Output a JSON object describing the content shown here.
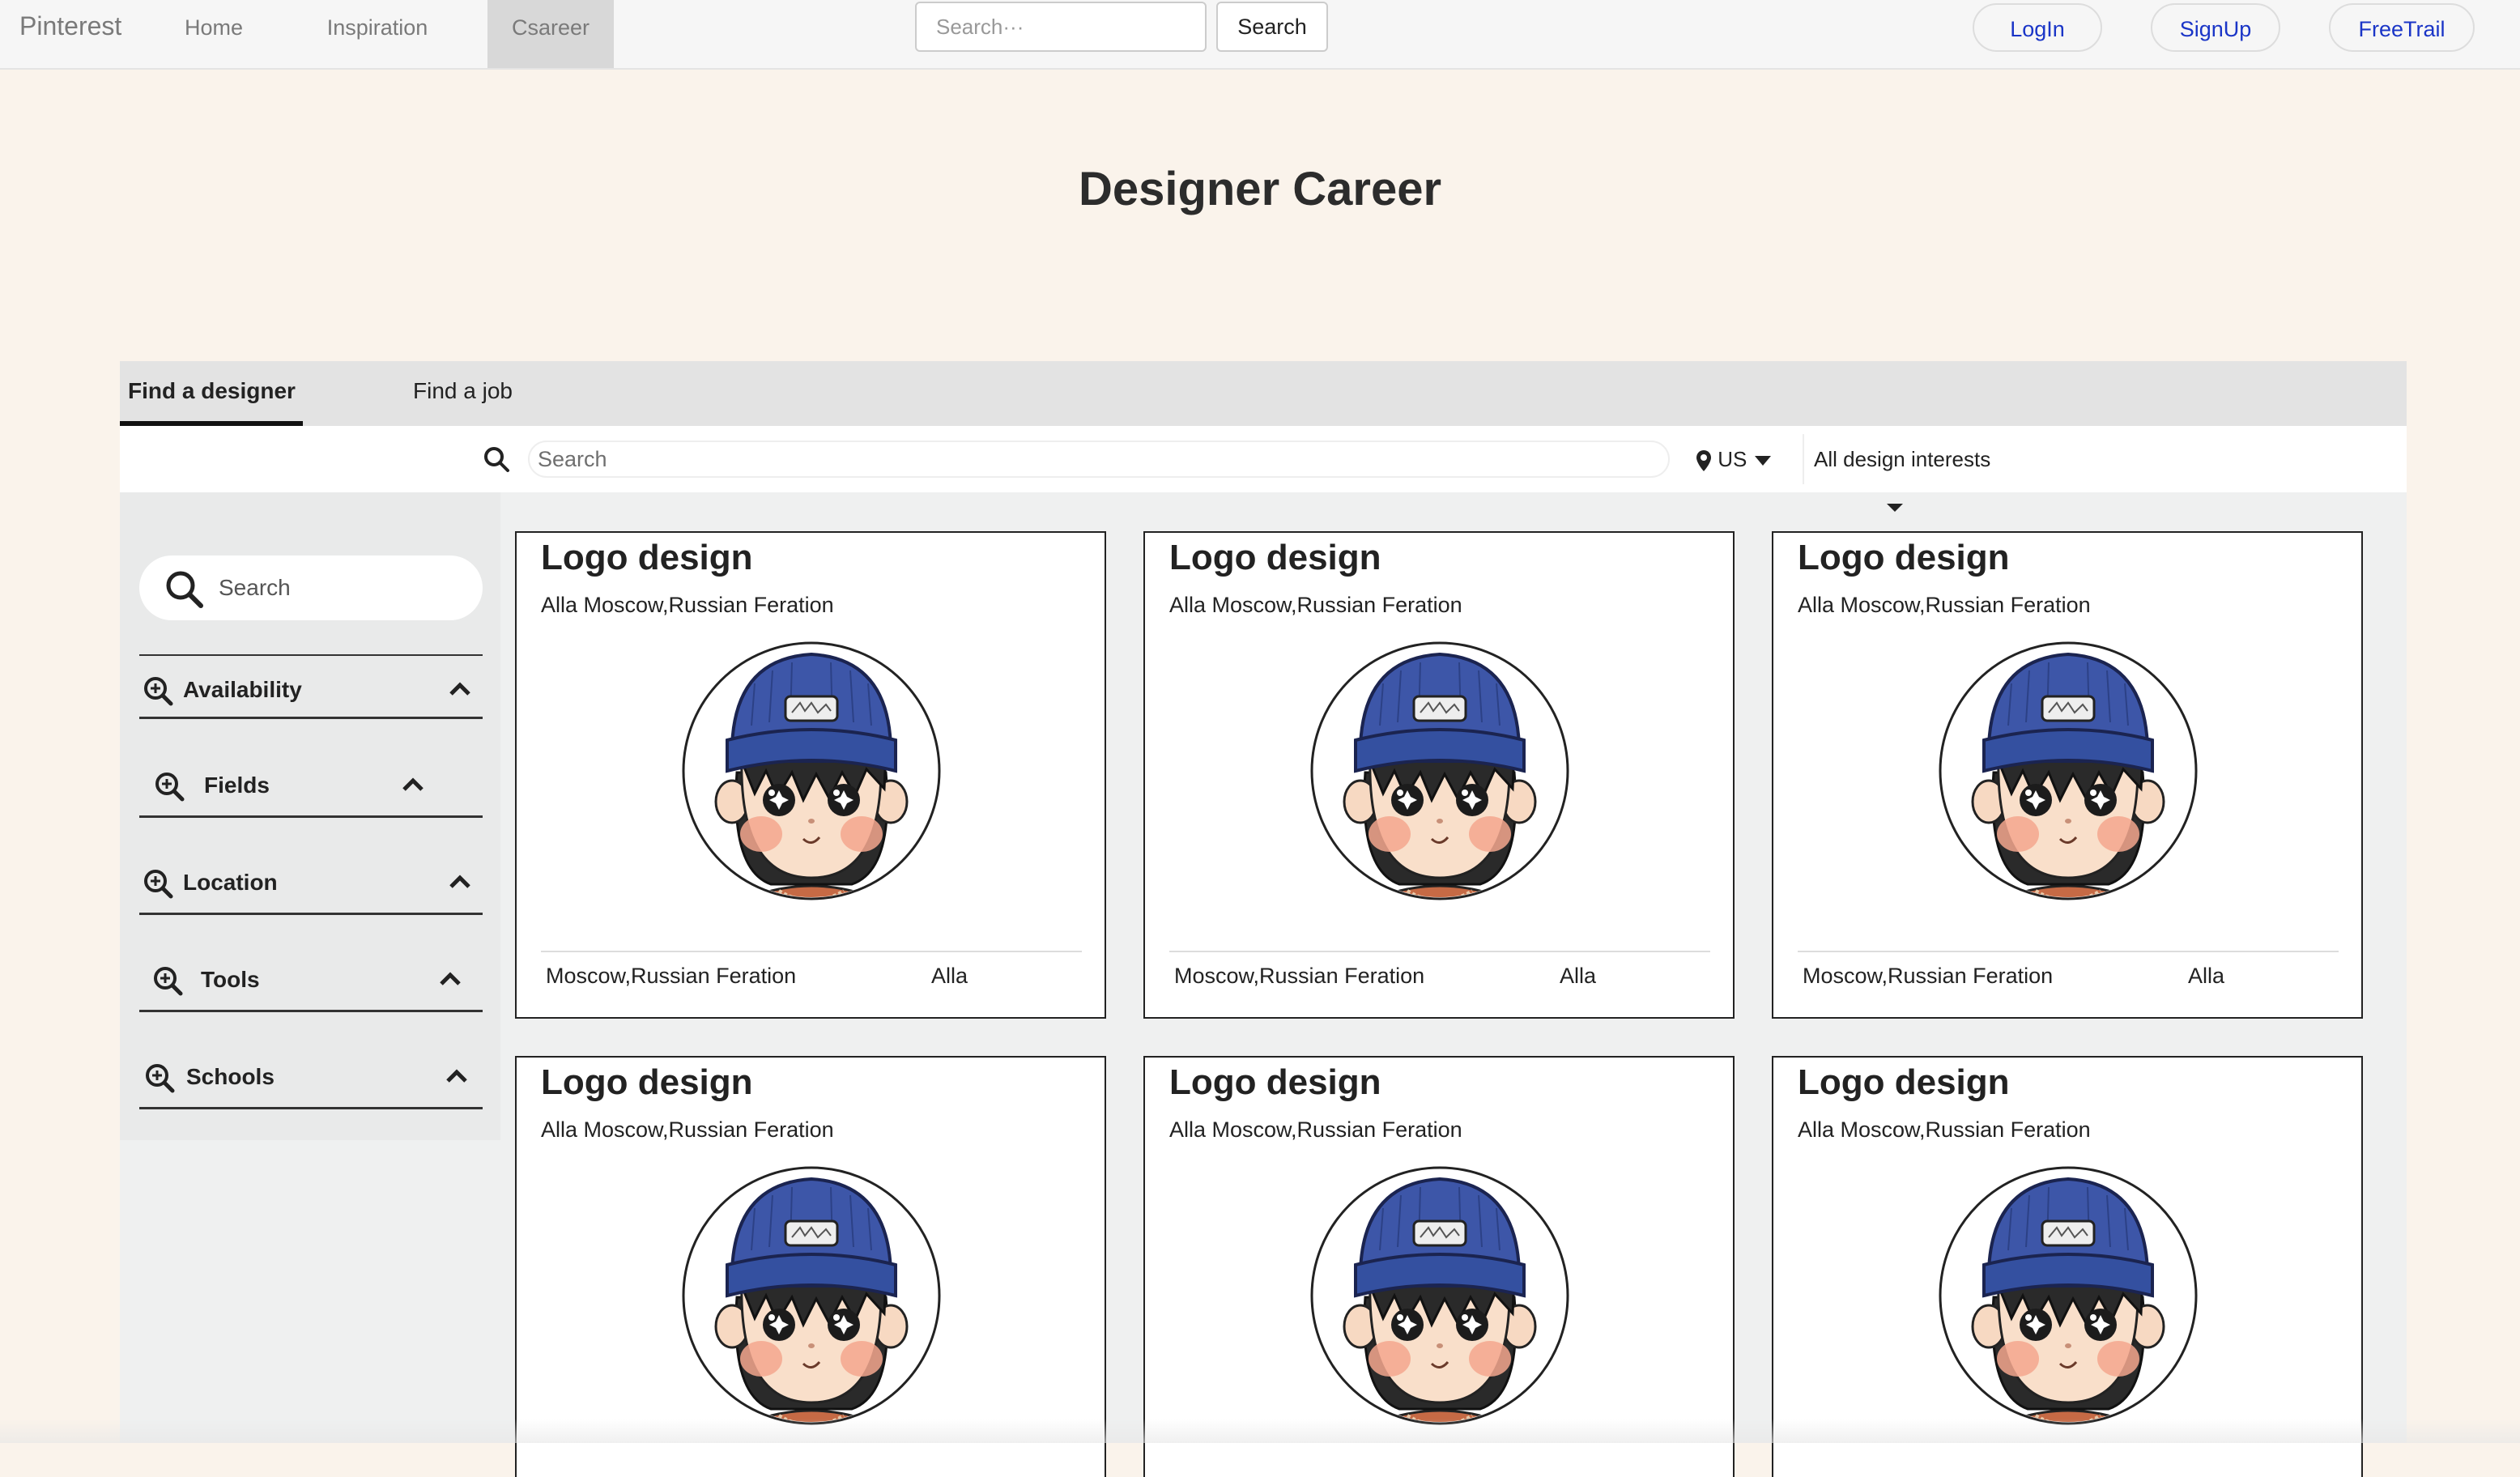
{
  "nav": {
    "brand": "Pinterest",
    "links": [
      "Home",
      "Inspiration",
      "Csareer"
    ],
    "active_link": "Csareer",
    "search_placeholder": "Search···",
    "search_button": "Search",
    "login": "LogIn",
    "signup": "SignUp",
    "free_trail": "FreeTrail"
  },
  "page": {
    "title": "Designer Career"
  },
  "tabs": [
    {
      "label": "Find a designer",
      "active": true
    },
    {
      "label": "Find a job",
      "active": false
    }
  ],
  "filter": {
    "search_placeholder": "Search",
    "location": "US",
    "interests": "All design interests"
  },
  "sidebar": {
    "search_placeholder": "Search",
    "facets": [
      "Availability",
      "Fields",
      "Location",
      "Tools",
      "Schools"
    ]
  },
  "cards": [
    {
      "title": "Logo design",
      "subtitle": "Alla Moscow,Russian Feration",
      "location": "Moscow,Russian Feration",
      "name": "Alla"
    },
    {
      "title": "Logo design",
      "subtitle": "Alla Moscow,Russian Feration",
      "location": "Moscow,Russian Feration",
      "name": "Alla"
    },
    {
      "title": "Logo design",
      "subtitle": "Alla Moscow,Russian Feration",
      "location": "Moscow,Russian Feration",
      "name": "Alla"
    },
    {
      "title": "Logo design",
      "subtitle": "Alla Moscow,Russian Feration"
    },
    {
      "title": "Logo design",
      "subtitle": "Alla Moscow,Russian Feration"
    },
    {
      "title": "Logo design",
      "subtitle": "Alla Moscow,Russian Feration"
    }
  ],
  "colors": {
    "accent_link": "#1a35c7",
    "page_bg": "#faf3eb",
    "beanie": "#3d56a8"
  }
}
